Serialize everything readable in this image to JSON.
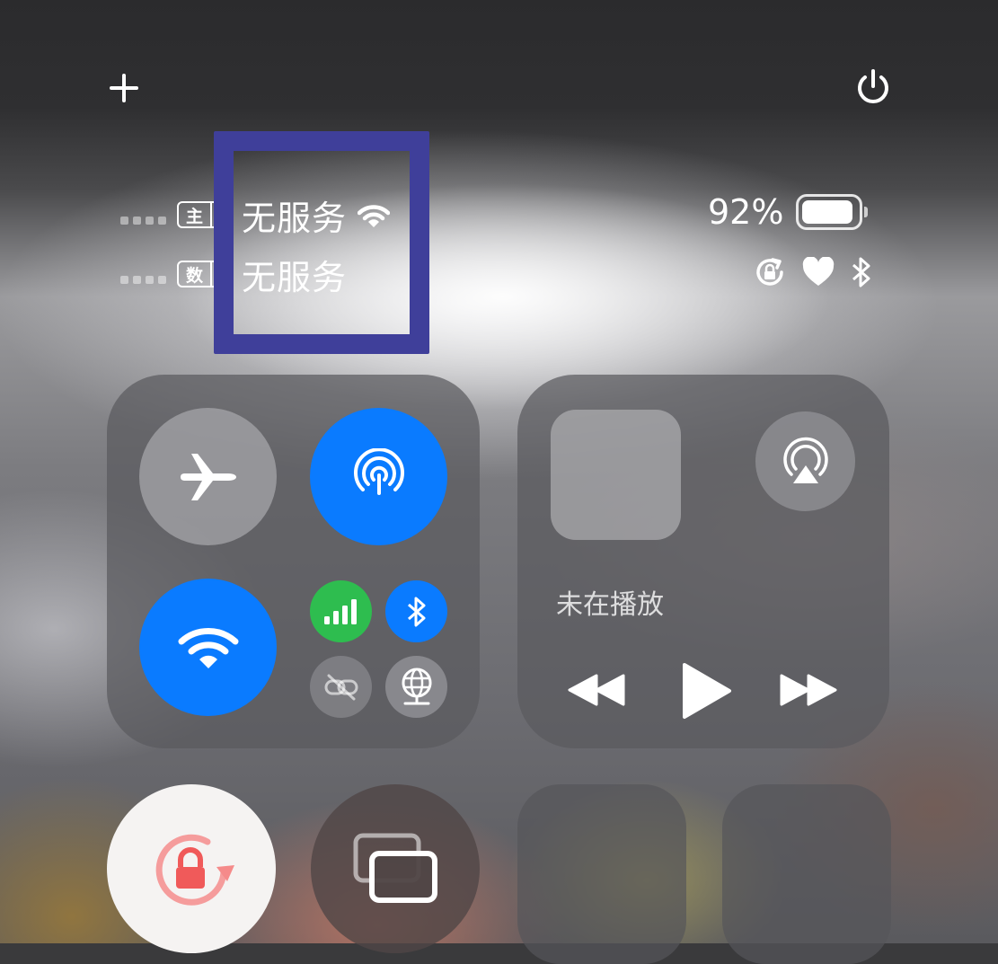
{
  "status_bar": {
    "sim1": {
      "badge": "主",
      "carrier": "无服务"
    },
    "sim2": {
      "badge": "数",
      "carrier": "无服务"
    },
    "battery": {
      "percent_label": "92%",
      "level": 0.92
    }
  },
  "media": {
    "now_playing": "未在播放"
  },
  "colors": {
    "accent_blue": "#0a7bff",
    "cellular_green": "#2ebd4f",
    "highlight_box": "#3f3f9a",
    "rotation_lock_red": "#f05a5a"
  },
  "icons": {
    "top_left": "plus-icon",
    "top_right": "power-icon",
    "connectivity": [
      "airplane-icon",
      "airdrop-icon",
      "wifi-icon",
      "cellular-icon",
      "bluetooth-icon",
      "personal-hotspot-icon",
      "vpn-globe-icon"
    ],
    "media": [
      "airplay-icon",
      "previous-track-icon",
      "play-icon",
      "next-track-icon"
    ],
    "bottom": [
      "rotation-lock-icon",
      "screen-mirroring-icon"
    ]
  }
}
